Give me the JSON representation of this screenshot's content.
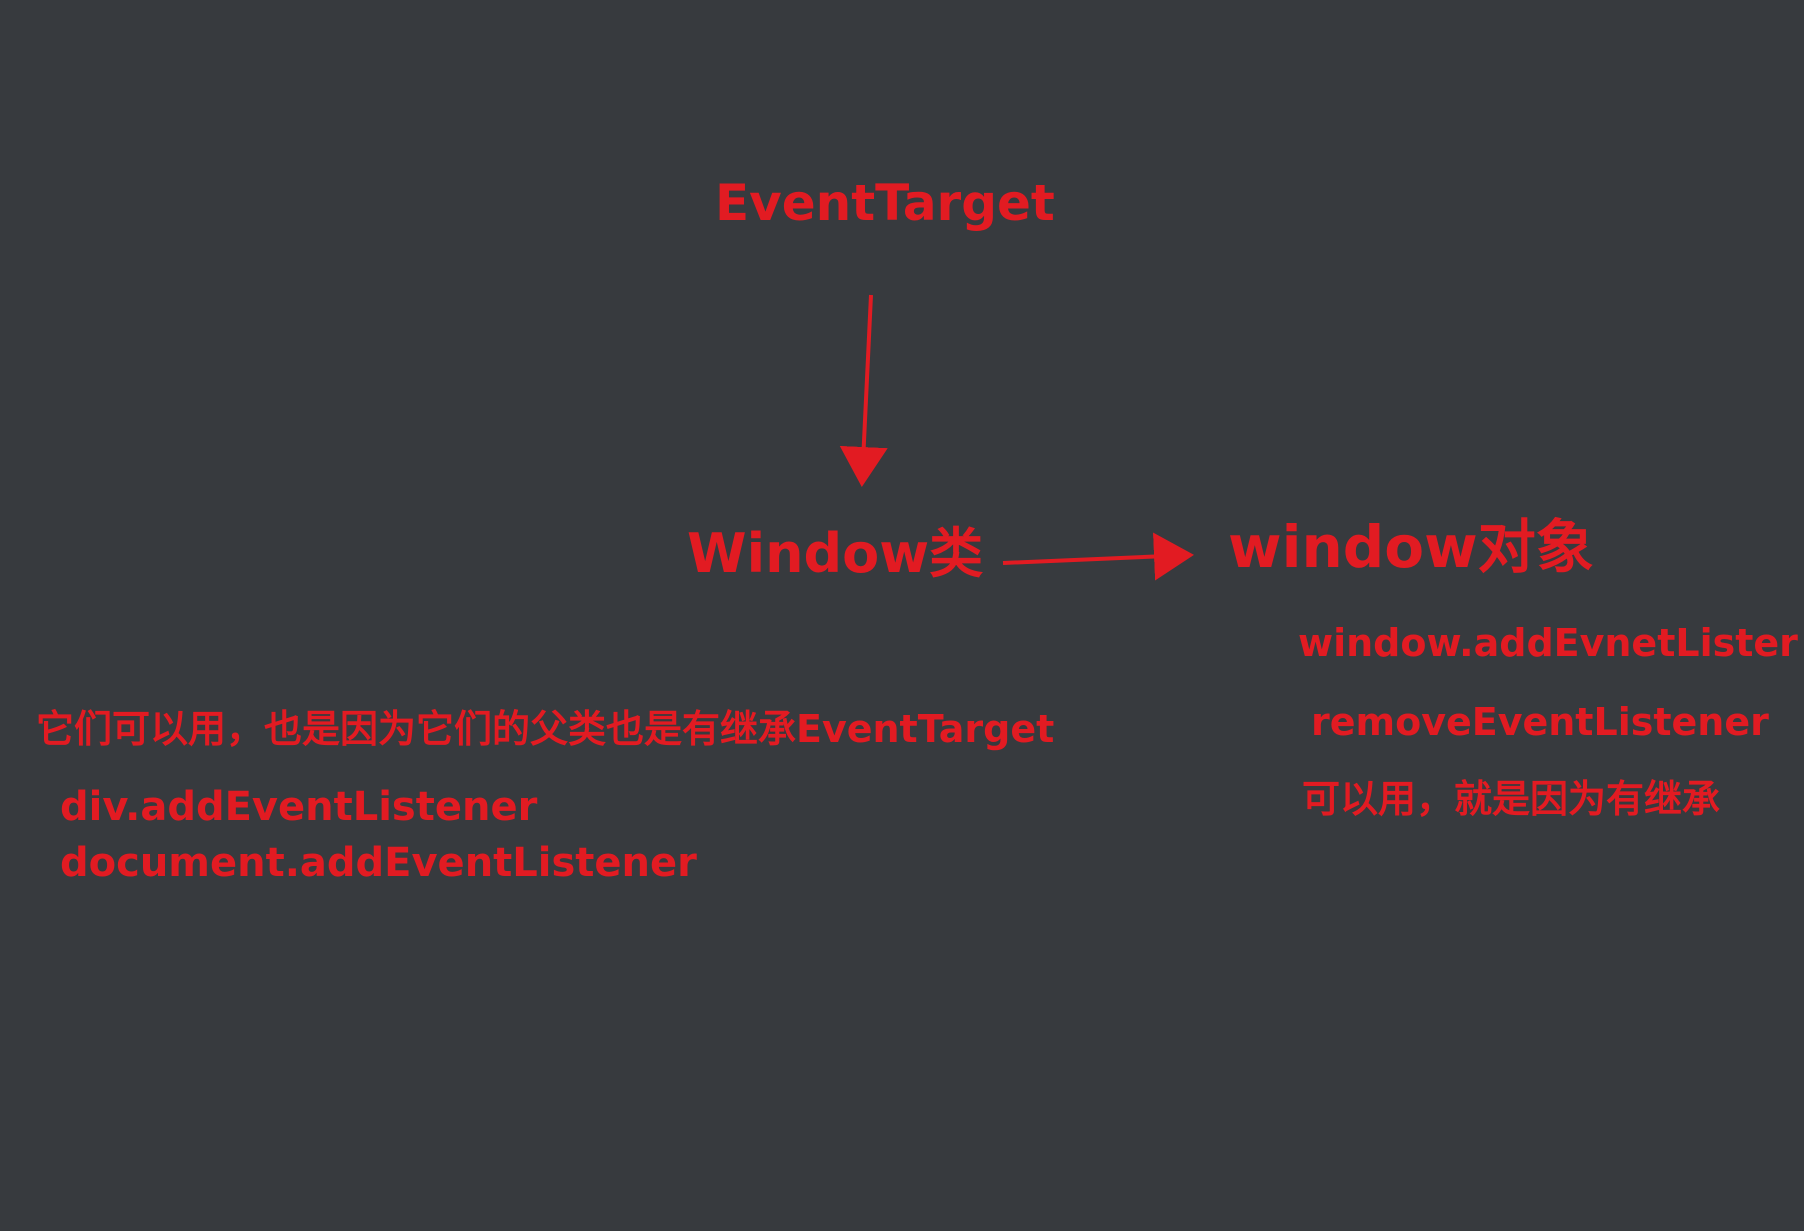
{
  "diagram": {
    "colors": {
      "background": "#373a3e",
      "text": "#e21b22"
    },
    "nodes": {
      "event_target": "EventTarget",
      "window_class": "Window类",
      "window_object": "window对象"
    },
    "notes": {
      "parent_inherit": "它们可以用，也是因为它们的父类也是有继承EventTarget",
      "div_add": "div.addEventListener",
      "document_add": "document.addEventListener",
      "window_add": "window.addEvnetLister",
      "remove": "removeEventListener",
      "because_inherit": "可以用，就是因为有继承"
    },
    "edges": [
      {
        "from": "EventTarget",
        "to": "Window类"
      },
      {
        "from": "Window类",
        "to": "window对象"
      }
    ]
  }
}
